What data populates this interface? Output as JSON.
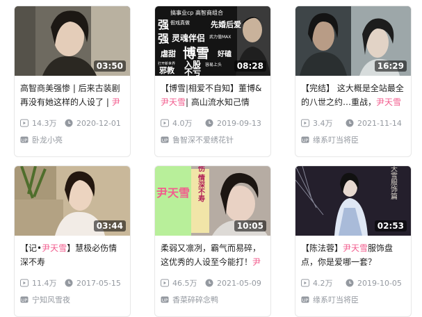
{
  "cards": [
    {
      "duration": "03:50",
      "title_pre": "高智商美强惨 | 后来古装剧再没有她这样的人设了 | ",
      "title_hl": "尹",
      "title_post": "",
      "views": "14.3万",
      "date": "2020-12-01",
      "author": "卧龙小亮"
    },
    {
      "duration": "08:28",
      "title_pre": "【博雪|相爱不自知】董博&",
      "title_hl": "尹天雪",
      "title_post": "| 高山流水知己情",
      "views": "4.0万",
      "date": "2019-09-13",
      "author": "鲁智深不爱绣花针",
      "thumb_text": {
        "line1": "搞事业cp  高智商组合",
        "line2a": "强",
        "line2b": "假戏真做",
        "line2c": "先婚后爱",
        "line3a": "强",
        "line3b": "灵魂伴侣",
        "line3c": "武力值MAX",
        "line4a": "虐甜",
        "line4b": "博雪",
        "line4c": "好磕",
        "line5a": "打开新世界",
        "line5b": "邪教",
        "line5c": "入股",
        "line5d": "容易上头",
        "line6": "不亏"
      }
    },
    {
      "duration": "16:29",
      "title_pre": "【完结】 这大概是全站最全的八世之约…重战，",
      "title_hl": "尹天雪",
      "title_post": "",
      "views": "3.4万",
      "date": "2021-11-14",
      "author": "缘系叮当将臣"
    },
    {
      "duration": "03:44",
      "title_pre": "【记•",
      "title_hl": "尹天雪",
      "title_post": "】慧极必伤情深不寿",
      "views": "11.4万",
      "date": "2017-05-15",
      "author": "宁知风雪夜"
    },
    {
      "duration": "10:05",
      "title_pre": "柔弱又凛冽，霸气而易碎，这优秀的人设至今能打！",
      "title_hl": "尹",
      "title_post": "",
      "views": "46.5万",
      "date": "2021-05-09",
      "author": "香菜碎碎念鸭",
      "thumb_text": {
        "side_name": "尹天雪",
        "vertical": "慧极必伤 情深不寿"
      }
    },
    {
      "duration": "02:53",
      "title_pre": "【陈法蓉】",
      "title_hl": "尹天雪",
      "title_post": "服饰盘点，你是爱哪一套？",
      "views": "4.2万",
      "date": "2019-10-05",
      "author": "缘系叮当将臣",
      "thumb_text": {
        "vertical": "尹天雪服饰篇"
      }
    }
  ],
  "colors": {
    "highlight": "#f25d8e",
    "meta": "#9499a0"
  },
  "icons": {
    "views": "play-count-icon",
    "date": "clock-icon",
    "author": "uploader-icon"
  }
}
